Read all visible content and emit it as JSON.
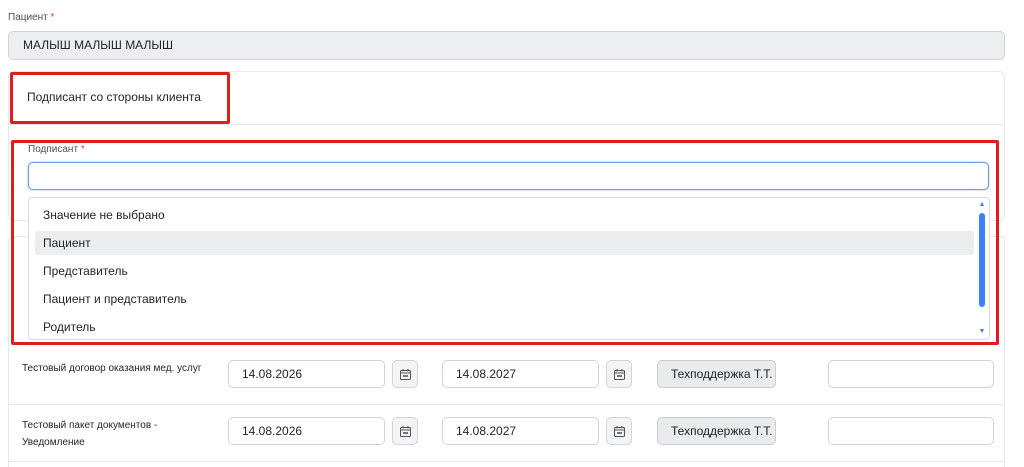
{
  "patient": {
    "label": "Пациент",
    "required_mark": "*",
    "value": "МАЛЫШ МАЛЫШ МАЛЫШ"
  },
  "signer_card": {
    "title": "Подписант со стороны клиента",
    "field_label": "Подписант",
    "required_mark": "*",
    "input_value": "",
    "options": [
      "Значение не выбрано",
      "Пациент",
      "Представитель",
      "Пациент и представитель",
      "Родитель"
    ],
    "hovered_option": "Пациент"
  },
  "documents": [
    {
      "name": "Тестовый договор оказания мед. услуг",
      "start_date": "14.08.2026",
      "end_date": "14.08.2027",
      "signer": "Техподдержка Т.Т.",
      "extra": ""
    },
    {
      "name": "Тестовый пакет документов - Уведомление",
      "start_date": "14.08.2026",
      "end_date": "14.08.2027",
      "signer": "Техподдержка Т.Т.",
      "extra": ""
    }
  ],
  "colors": {
    "highlight": "#e01d1d",
    "accent": "#3b82f6",
    "required": "#e03b3b"
  },
  "icons": {
    "calendar": "calendar-icon",
    "scroll_up": "scroll-up-arrow-icon",
    "scroll_down": "scroll-down-arrow-icon"
  }
}
